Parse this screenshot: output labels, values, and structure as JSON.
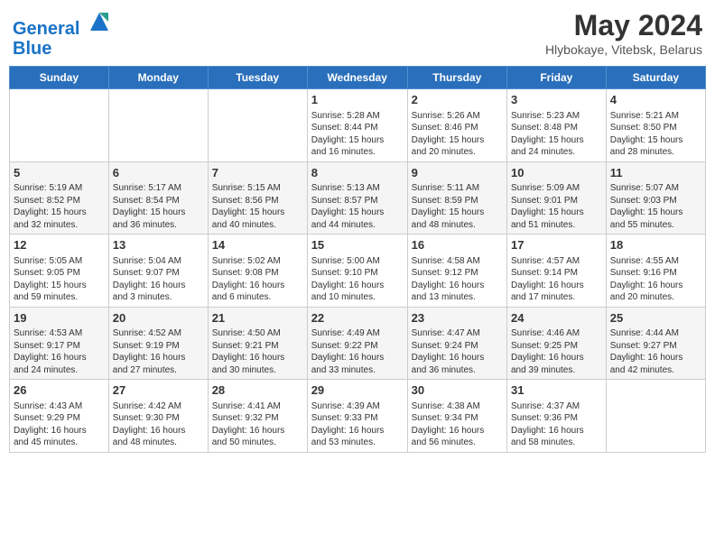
{
  "header": {
    "logo_line1": "General",
    "logo_line2": "Blue",
    "month": "May 2024",
    "location": "Hlybokaye, Vitebsk, Belarus"
  },
  "weekdays": [
    "Sunday",
    "Monday",
    "Tuesday",
    "Wednesday",
    "Thursday",
    "Friday",
    "Saturday"
  ],
  "weeks": [
    [
      {
        "day": "",
        "content": ""
      },
      {
        "day": "",
        "content": ""
      },
      {
        "day": "",
        "content": ""
      },
      {
        "day": "1",
        "content": "Sunrise: 5:28 AM\nSunset: 8:44 PM\nDaylight: 15 hours\nand 16 minutes."
      },
      {
        "day": "2",
        "content": "Sunrise: 5:26 AM\nSunset: 8:46 PM\nDaylight: 15 hours\nand 20 minutes."
      },
      {
        "day": "3",
        "content": "Sunrise: 5:23 AM\nSunset: 8:48 PM\nDaylight: 15 hours\nand 24 minutes."
      },
      {
        "day": "4",
        "content": "Sunrise: 5:21 AM\nSunset: 8:50 PM\nDaylight: 15 hours\nand 28 minutes."
      }
    ],
    [
      {
        "day": "5",
        "content": "Sunrise: 5:19 AM\nSunset: 8:52 PM\nDaylight: 15 hours\nand 32 minutes."
      },
      {
        "day": "6",
        "content": "Sunrise: 5:17 AM\nSunset: 8:54 PM\nDaylight: 15 hours\nand 36 minutes."
      },
      {
        "day": "7",
        "content": "Sunrise: 5:15 AM\nSunset: 8:56 PM\nDaylight: 15 hours\nand 40 minutes."
      },
      {
        "day": "8",
        "content": "Sunrise: 5:13 AM\nSunset: 8:57 PM\nDaylight: 15 hours\nand 44 minutes."
      },
      {
        "day": "9",
        "content": "Sunrise: 5:11 AM\nSunset: 8:59 PM\nDaylight: 15 hours\nand 48 minutes."
      },
      {
        "day": "10",
        "content": "Sunrise: 5:09 AM\nSunset: 9:01 PM\nDaylight: 15 hours\nand 51 minutes."
      },
      {
        "day": "11",
        "content": "Sunrise: 5:07 AM\nSunset: 9:03 PM\nDaylight: 15 hours\nand 55 minutes."
      }
    ],
    [
      {
        "day": "12",
        "content": "Sunrise: 5:05 AM\nSunset: 9:05 PM\nDaylight: 15 hours\nand 59 minutes."
      },
      {
        "day": "13",
        "content": "Sunrise: 5:04 AM\nSunset: 9:07 PM\nDaylight: 16 hours\nand 3 minutes."
      },
      {
        "day": "14",
        "content": "Sunrise: 5:02 AM\nSunset: 9:08 PM\nDaylight: 16 hours\nand 6 minutes."
      },
      {
        "day": "15",
        "content": "Sunrise: 5:00 AM\nSunset: 9:10 PM\nDaylight: 16 hours\nand 10 minutes."
      },
      {
        "day": "16",
        "content": "Sunrise: 4:58 AM\nSunset: 9:12 PM\nDaylight: 16 hours\nand 13 minutes."
      },
      {
        "day": "17",
        "content": "Sunrise: 4:57 AM\nSunset: 9:14 PM\nDaylight: 16 hours\nand 17 minutes."
      },
      {
        "day": "18",
        "content": "Sunrise: 4:55 AM\nSunset: 9:16 PM\nDaylight: 16 hours\nand 20 minutes."
      }
    ],
    [
      {
        "day": "19",
        "content": "Sunrise: 4:53 AM\nSunset: 9:17 PM\nDaylight: 16 hours\nand 24 minutes."
      },
      {
        "day": "20",
        "content": "Sunrise: 4:52 AM\nSunset: 9:19 PM\nDaylight: 16 hours\nand 27 minutes."
      },
      {
        "day": "21",
        "content": "Sunrise: 4:50 AM\nSunset: 9:21 PM\nDaylight: 16 hours\nand 30 minutes."
      },
      {
        "day": "22",
        "content": "Sunrise: 4:49 AM\nSunset: 9:22 PM\nDaylight: 16 hours\nand 33 minutes."
      },
      {
        "day": "23",
        "content": "Sunrise: 4:47 AM\nSunset: 9:24 PM\nDaylight: 16 hours\nand 36 minutes."
      },
      {
        "day": "24",
        "content": "Sunrise: 4:46 AM\nSunset: 9:25 PM\nDaylight: 16 hours\nand 39 minutes."
      },
      {
        "day": "25",
        "content": "Sunrise: 4:44 AM\nSunset: 9:27 PM\nDaylight: 16 hours\nand 42 minutes."
      }
    ],
    [
      {
        "day": "26",
        "content": "Sunrise: 4:43 AM\nSunset: 9:29 PM\nDaylight: 16 hours\nand 45 minutes."
      },
      {
        "day": "27",
        "content": "Sunrise: 4:42 AM\nSunset: 9:30 PM\nDaylight: 16 hours\nand 48 minutes."
      },
      {
        "day": "28",
        "content": "Sunrise: 4:41 AM\nSunset: 9:32 PM\nDaylight: 16 hours\nand 50 minutes."
      },
      {
        "day": "29",
        "content": "Sunrise: 4:39 AM\nSunset: 9:33 PM\nDaylight: 16 hours\nand 53 minutes."
      },
      {
        "day": "30",
        "content": "Sunrise: 4:38 AM\nSunset: 9:34 PM\nDaylight: 16 hours\nand 56 minutes."
      },
      {
        "day": "31",
        "content": "Sunrise: 4:37 AM\nSunset: 9:36 PM\nDaylight: 16 hours\nand 58 minutes."
      },
      {
        "day": "",
        "content": ""
      }
    ]
  ]
}
